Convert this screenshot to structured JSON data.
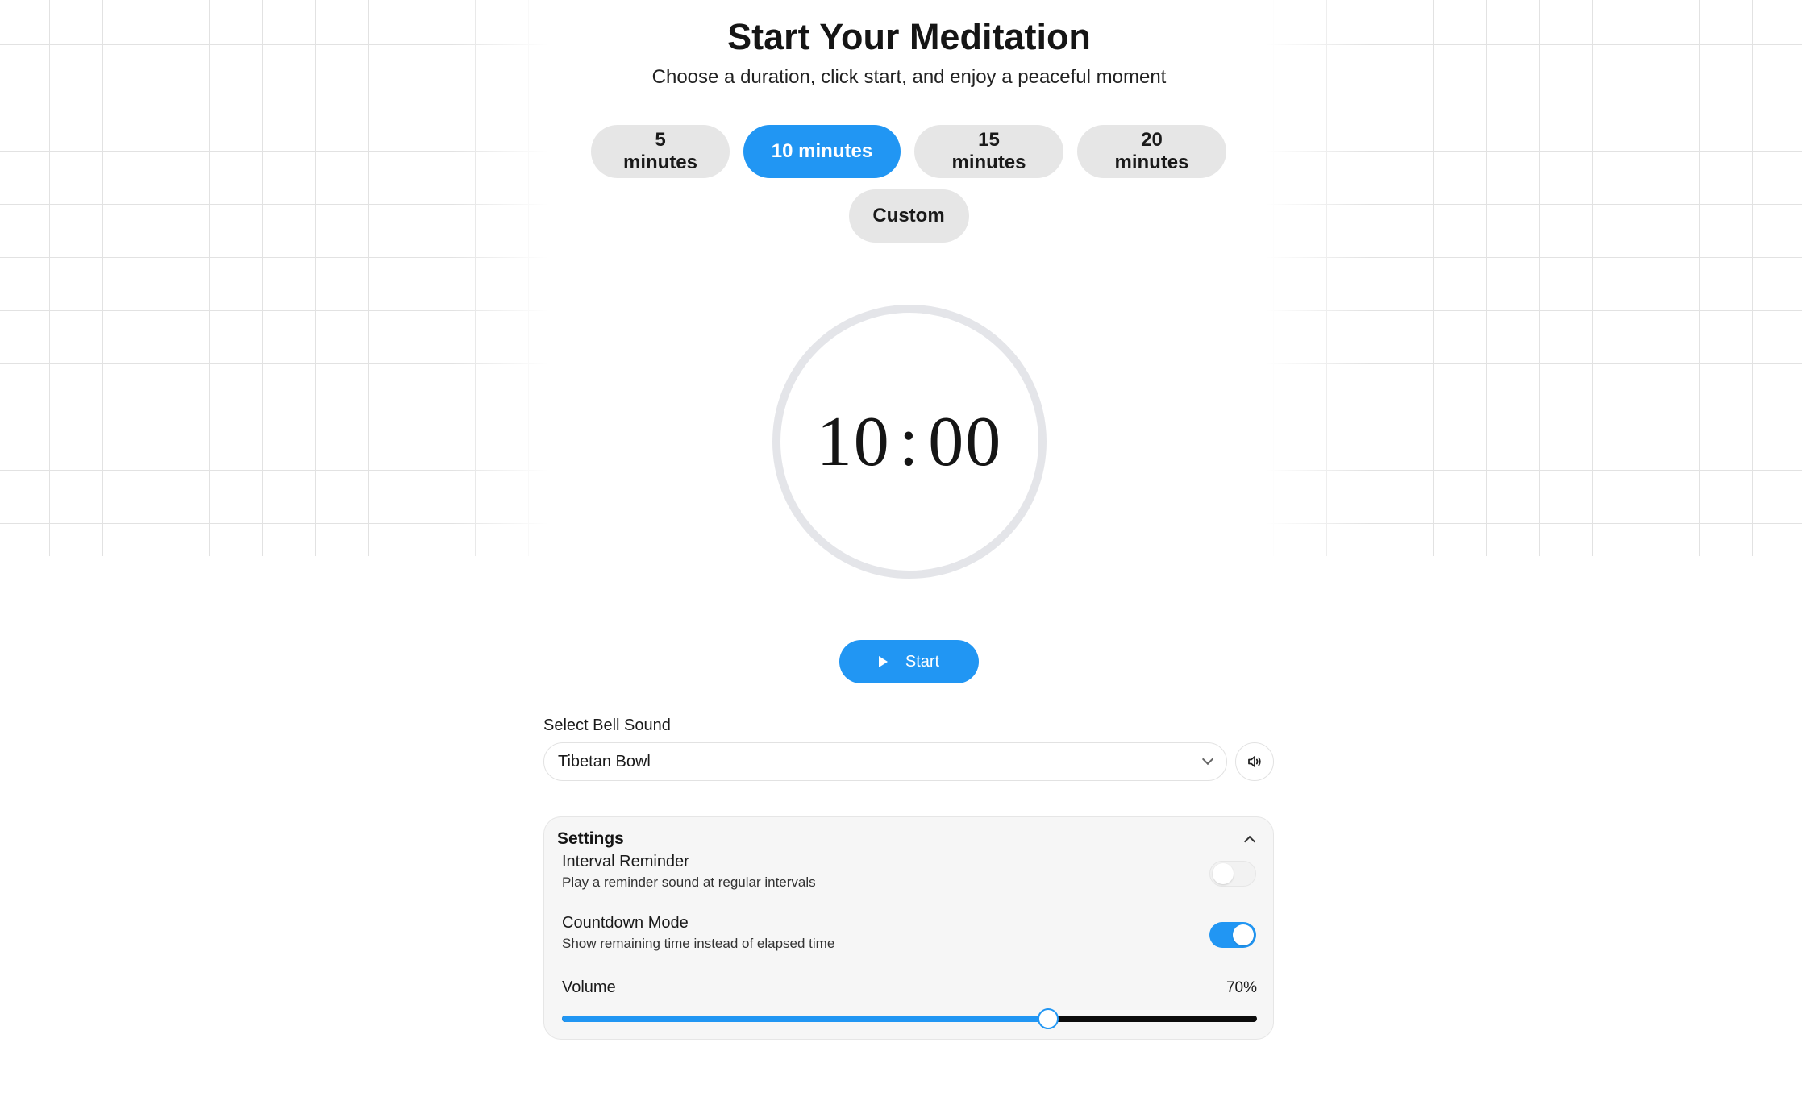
{
  "header": {
    "title": "Start Your Meditation",
    "subtitle": "Choose a duration, click start, and enjoy a peaceful moment"
  },
  "durations": [
    {
      "label": "5 minutes",
      "active": false
    },
    {
      "label": "10 minutes",
      "active": true
    },
    {
      "label": "15 minutes",
      "active": false
    },
    {
      "label": "20 minutes",
      "active": false
    },
    {
      "label": "Custom",
      "active": false
    }
  ],
  "timer": {
    "minutes": "10",
    "separator": ":",
    "seconds": "00"
  },
  "start_button": {
    "label": "Start",
    "icon": "play-icon"
  },
  "bell": {
    "label": "Select Bell Sound",
    "selected": "Tibetan Bowl",
    "preview_icon": "speaker-icon"
  },
  "settings": {
    "title": "Settings",
    "expanded": true,
    "interval_reminder": {
      "title": "Interval Reminder",
      "description": "Play a reminder sound at regular intervals",
      "enabled": false
    },
    "countdown_mode": {
      "title": "Countdown Mode",
      "description": "Show remaining time instead of elapsed time",
      "enabled": true
    },
    "volume": {
      "label": "Volume",
      "display": "70%",
      "value": 0.7
    }
  },
  "colors": {
    "accent": "#2196f3",
    "button_bg": "#e6e6e6",
    "ring": "#e4e5e9",
    "panel_bg": "#f6f6f6"
  }
}
